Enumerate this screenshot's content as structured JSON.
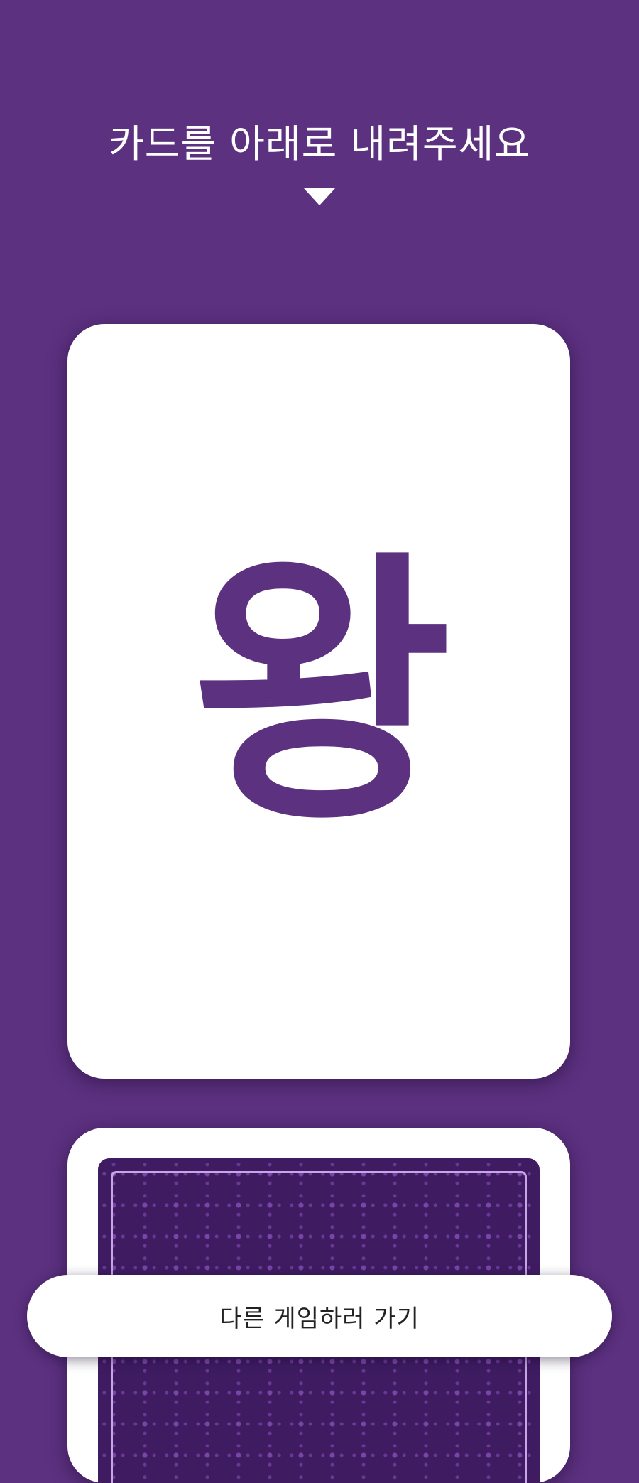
{
  "header": {
    "instruction": "카드를 아래로 내려주세요",
    "arrow_icon": "triangle-down-icon"
  },
  "card_front": {
    "text": "왕"
  },
  "card_back": {
    "pattern_icon": "card-back-pattern"
  },
  "bottom": {
    "button_label": "다른 게임하러 가기"
  },
  "colors": {
    "background": "#5c3180",
    "card": "#ffffff",
    "accent": "#5c3180",
    "card_back": "#3f1c62"
  }
}
